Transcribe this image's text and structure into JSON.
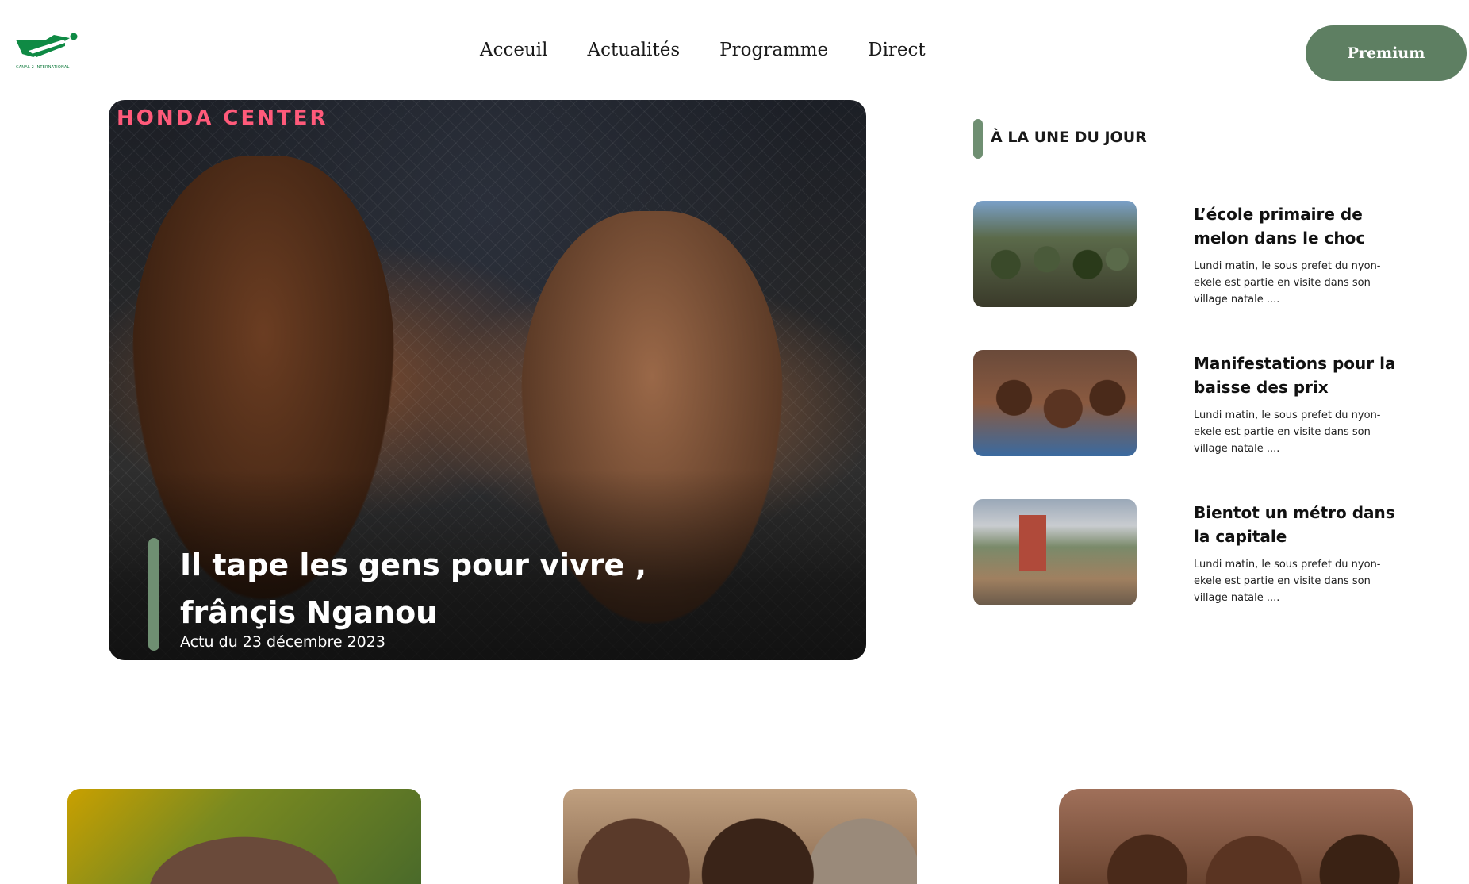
{
  "header": {
    "logo_text": "CANAL 2 INTERNATIONAL",
    "nav": [
      "Acceuil",
      "Actualités",
      "Programme",
      "Direct"
    ],
    "premium_label": "Premium"
  },
  "hero": {
    "banner_text": "HONDA CENTER",
    "title": "Il tape les gens pour vivre , frânçis Nganou",
    "date": "Actu du 23 décembre 2023"
  },
  "sidebar": {
    "title": "À LA UNE DU JOUR",
    "items": [
      {
        "title": "L’école primaire de melon dans le choc",
        "description": "Lundi matin, le sous prefet du nyon-ekele est partie en visite dans son village natale ...."
      },
      {
        "title": "Manifestations pour la baisse des prix",
        "description": "Lundi matin, le sous prefet du nyon-ekele est partie en visite dans son village natale ...."
      },
      {
        "title": "Bientot un métro dans la capitale",
        "description": "Lundi matin, le sous prefet du nyon-ekele est partie en visite dans son village natale ...."
      }
    ]
  },
  "colors": {
    "accent": "#5e7f62",
    "accent_light": "#6f8f72",
    "logo_green": "#0f7a3c"
  }
}
